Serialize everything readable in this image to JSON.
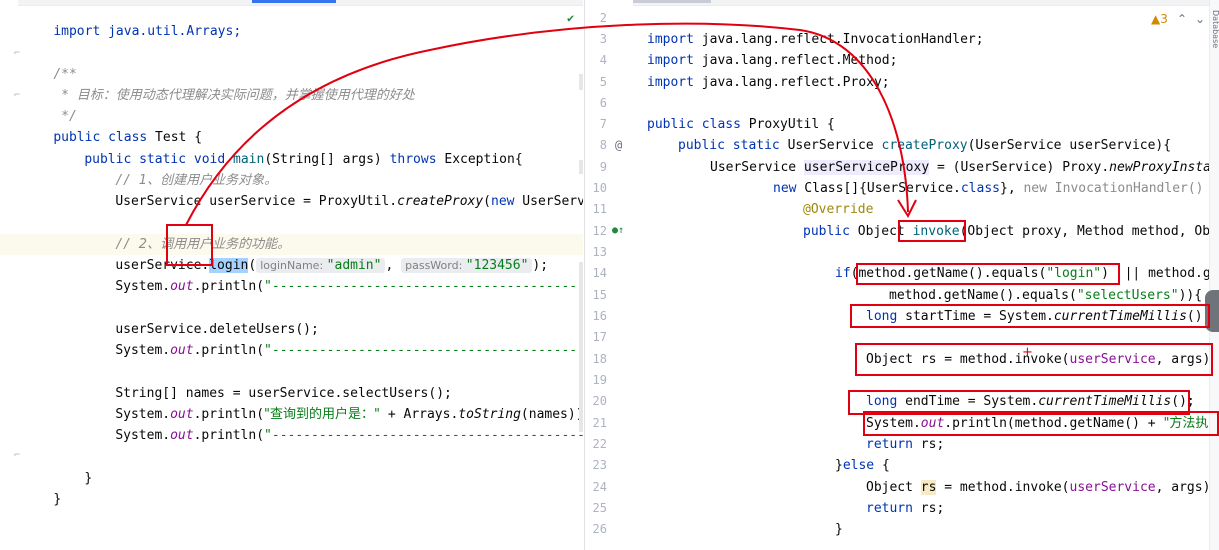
{
  "left_editor": {
    "lines": [
      {
        "id": "l0",
        "text": "import java.util.Arrays;"
      },
      {
        "id": "l1",
        "text": "/**"
      },
      {
        "id": "l2",
        "prefix": " * ",
        "comment": "目标：使用动态代理解决实际问题，并掌握使用代理的好处"
      },
      {
        "id": "l3",
        "text": " */"
      },
      {
        "id": "l4",
        "kw": "public class",
        "rest": " Test {"
      },
      {
        "id": "l5",
        "kw1": "public static void",
        "name": " main",
        "mid": "(String[] args) ",
        "kw2": "throws",
        "rest": " Exception{"
      },
      {
        "id": "l6",
        "prefix": "// ",
        "comment": "1、创建用户业务对象。"
      },
      {
        "id": "l7",
        "pre": "UserService userService = ProxyUtil.",
        "italic": "createProxy",
        "mid": "(",
        "kw": "new",
        "rest": " UserServiceI"
      },
      {
        "id": "l8",
        "prefix": "// ",
        "comment": "2、调用用户业务的功能。"
      },
      {
        "id": "l9",
        "a": "userService.",
        "sel": "login",
        "b": "(",
        "hint1": "loginName:",
        "v1": "\"admin\"",
        "c": ", ",
        "hint2": "passWord:",
        "v2": "\"123456\"",
        "d": ");"
      },
      {
        "id": "l10",
        "a": "System.",
        "st": "out",
        "b": ".println(",
        "s": "\"-------------------------------------------"
      },
      {
        "id": "l11",
        "text": "userService.deleteUsers();"
      },
      {
        "id": "l12",
        "a": "System.",
        "st": "out",
        "b": ".println(",
        "s": "\"-------------------------------------------"
      },
      {
        "id": "l13",
        "text": "String[] names = userService.selectUsers();"
      },
      {
        "id": "l14",
        "a": "System.",
        "st": "out",
        "b": ".println(",
        "s": "\"查询到的用户是：\"",
        "c": " + Arrays.",
        "it": "toString",
        "d": "(names));"
      },
      {
        "id": "l15",
        "a": "System.",
        "st": "out",
        "b": ".println(",
        "s": "\"-------------------------------------------"
      },
      {
        "id": "l16",
        "text": "}"
      },
      {
        "id": "l17",
        "text": "}"
      }
    ]
  },
  "right_editor": {
    "inspection": {
      "count": "3",
      "icon": "warning-triangle-icon"
    },
    "line_numbers": [
      "2",
      "3",
      "4",
      "5",
      "6",
      "7",
      "8",
      "9",
      "10",
      "11",
      "12",
      "13",
      "14",
      "15",
      "16",
      "17",
      "18",
      "19",
      "20",
      "21",
      "22",
      "23",
      "24",
      "25",
      "26"
    ],
    "lines": {
      "r3": {
        "kw": "import",
        "rest": " java.lang.reflect.InvocationHandler;"
      },
      "r4": {
        "kw": "import",
        "rest": " java.lang.reflect.Method;"
      },
      "r5": {
        "kw": "import",
        "rest": " java.lang.reflect.Proxy;"
      },
      "r7": {
        "kw": "public class",
        "rest": " ProxyUtil {"
      },
      "r8": {
        "kw": "public static",
        "a": " UserService ",
        "m": "createProxy",
        "b": "(UserService userService){"
      },
      "r9": {
        "a": "UserService ",
        "v": "userServiceProxy",
        "b": " = (UserService) Proxy.",
        "it": "newProxyInsta"
      },
      "r10": {
        "kw": "new",
        "a": " Class[]{UserService.",
        "kw2": "class",
        "b": "}, ",
        "kw3": "new",
        "c": " InvocationHandler()"
      },
      "r11": {
        "ann": "@Override"
      },
      "r12": {
        "kw": "public",
        "a": " Object ",
        "m": "invoke",
        "b": "(Object proxy, Method method, Ob"
      },
      "r14": {
        "kw": "if",
        "a": "(method.getName().equals(",
        "s": "\"login\"",
        "b": ")  || method.ge"
      },
      "r15": {
        "a": "method.getName().equals(",
        "s": "\"selectUsers\"",
        "b": ")){"
      },
      "r16": {
        "kw": "long",
        "a": " startTime = System.",
        "it": "currentTimeMillis",
        "b": "();"
      },
      "r18": {
        "a": "Object rs = method.invoke(",
        "p": "userService",
        "b": ", args)"
      },
      "r20": {
        "kw": "long",
        "a": " endTime = System.",
        "it": "currentTimeMillis",
        "b": "();"
      },
      "r21": {
        "a": "System.",
        "st": "out",
        "b": ".println(method.getName() + ",
        "s": "\"方法执"
      },
      "r22": {
        "kw": "return",
        "a": " rs;"
      },
      "r23": {
        "a": "}",
        "kw": "else",
        "b": " {"
      },
      "r24": {
        "a": "Object ",
        "v": "rs",
        "b": " = method.invoke(",
        "p": "userService",
        "c": ", args)"
      },
      "r25": {
        "kw": "return",
        "a": " rs;"
      },
      "r26": {
        "a": "}"
      }
    }
  },
  "right_edge_tab": "Database"
}
